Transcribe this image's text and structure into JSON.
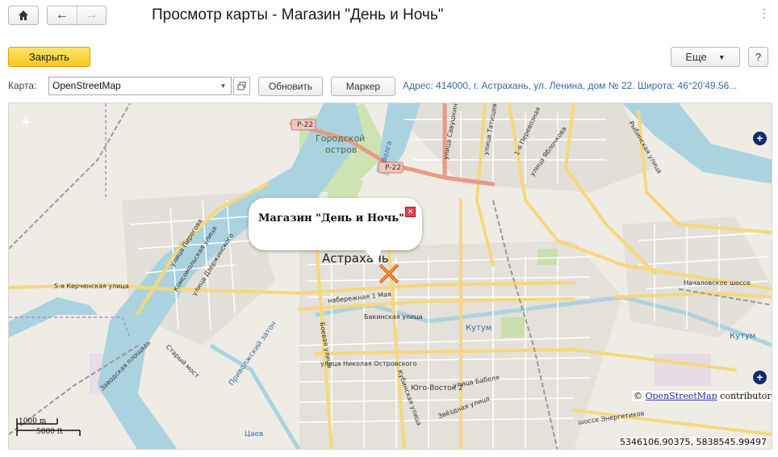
{
  "toolbar": {
    "back_icon": "←",
    "forward_icon": "→"
  },
  "window": {
    "title": "Просмотр карты - Магазин \"День и Ночь\"",
    "more_menu": "⋮"
  },
  "commands": {
    "close": "Закрыть",
    "more": "Еще",
    "help": "?"
  },
  "map_settings": {
    "label": "Карта:",
    "provider": "OpenStreetMap",
    "refresh": "Обновить",
    "marker": "Маркер",
    "address": "Адрес: 414000, г. Астрахань, ул. Ленина, дом № 22. Широта: 46°20'49.56..."
  },
  "map": {
    "popup": "Магазин \"День и Ночь\"",
    "city": "Астрахань",
    "island": [
      "Городской",
      "остров"
    ],
    "roads": {
      "r22a": "Р-22",
      "r22b": "Р-22",
      "kerch": "5-я Керченская улица",
      "naberezh": "набережная 1 Мая",
      "bakin": "Бакинская улица",
      "nik": "улица Николая Островского",
      "boev": "Боевая улица",
      "babel": "улица Бабеля",
      "kubin": "Кубинская улица",
      "zvezd": "Звёздная улица",
      "energ": "шоссе Энергетиков",
      "nachal": "Началовское шоссе",
      "rybin": "Рыбинская улица",
      "kutum": "Кутум",
      "kutum2": "Кутум",
      "pirog": "улица Пирогова",
      "komsom": "Комсомольская улица",
      "dzerzh": "улица Дзержинского",
      "zavod": "Заводская площадь",
      "stariy": "Старый мост",
      "yuzhvost": "Юго-Восток 2",
      "tatish": "улица Татищева",
      "yabl": "улица Яблочкова",
      "savush": "улица Савушкина",
      "perevoz": "1-я Перевозная",
      "volga": "Волга",
      "privolzh": "Приволжский затон",
      "tsaev": "Цаев"
    },
    "attribution_prefix": "©",
    "attribution_link": "OpenStreetMap",
    "attribution_suffix": "contributors",
    "scale_metric": "1000 m",
    "scale_imperial": "5000 ft",
    "coordinates": "5346106.90375, 5838545.99497",
    "zoom_in_icon": "+",
    "layer_icon": "+",
    "popup_close_icon": "✕"
  },
  "colors": {
    "accent": "#f6c820",
    "address": "#3a6aa8",
    "water": "#aad3df",
    "major_road": "#f7d77b",
    "trunk": "#e99a86"
  }
}
